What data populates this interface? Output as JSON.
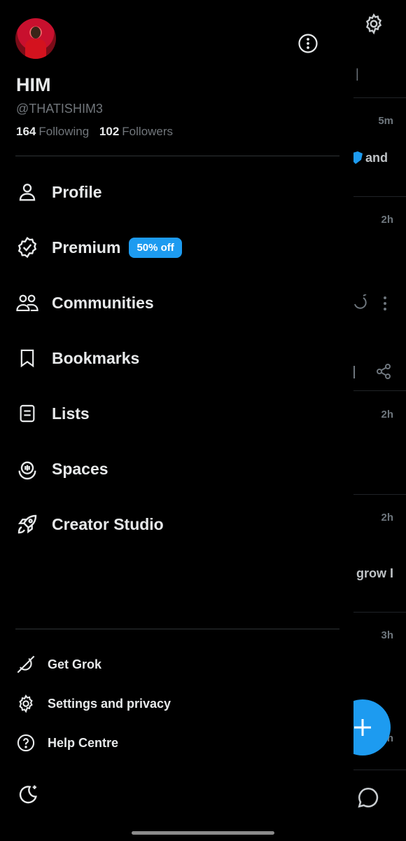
{
  "feed": {
    "times": [
      "5m",
      "2h",
      "2h",
      "2h",
      "3h",
      "2h"
    ],
    "fragments": [
      "and",
      "grow I"
    ]
  },
  "profile": {
    "name": "HIM",
    "handle": "@THATISHIM3",
    "following_count": "164",
    "following_label": "Following",
    "followers_count": "102",
    "followers_label": "Followers"
  },
  "menu": {
    "items": [
      {
        "label": "Profile",
        "icon": "person-icon"
      },
      {
        "label": "Premium",
        "icon": "verified-badge-icon",
        "badge": "50% off"
      },
      {
        "label": "Communities",
        "icon": "people-icon"
      },
      {
        "label": "Bookmarks",
        "icon": "bookmark-icon"
      },
      {
        "label": "Lists",
        "icon": "list-icon"
      },
      {
        "label": "Spaces",
        "icon": "spaces-mic-icon"
      },
      {
        "label": "Creator Studio",
        "icon": "rocket-icon"
      }
    ]
  },
  "secondary": {
    "items": [
      {
        "label": "Get Grok",
        "icon": "grok-icon"
      },
      {
        "label": "Settings and privacy",
        "icon": "gear-icon"
      },
      {
        "label": "Help Centre",
        "icon": "help-icon"
      }
    ]
  },
  "colors": {
    "accent": "#1d9bf0",
    "text": "#e7e9ea",
    "muted": "#71767b",
    "background": "#000000"
  }
}
